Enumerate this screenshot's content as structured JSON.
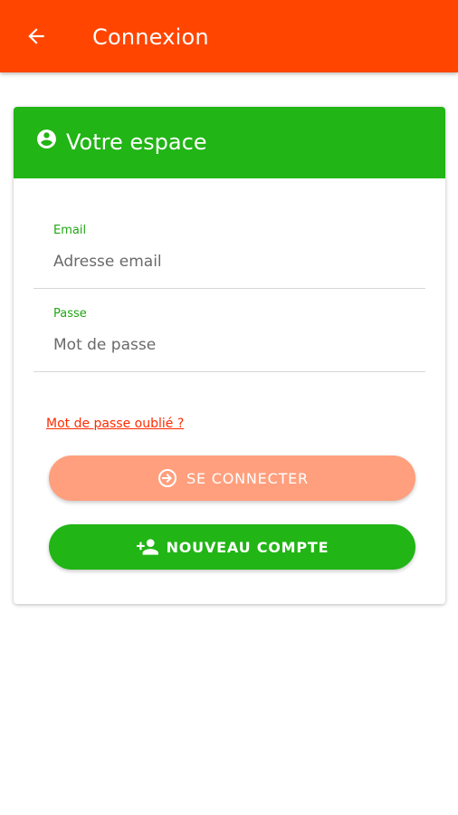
{
  "app_bar": {
    "title": "Connexion",
    "back_icon": "arrow-back-icon",
    "color": "#ff4500"
  },
  "card": {
    "header": {
      "title": "Votre espace",
      "icon": "account-circle-icon",
      "color": "#21b515"
    },
    "email": {
      "label": "Email",
      "value": "",
      "placeholder": "Adresse email"
    },
    "password": {
      "label": "Passe",
      "value": "",
      "placeholder": "Mot de passe"
    },
    "forgot_password": "Mot de passe oublié ?",
    "login_button": {
      "label": "SE CONNECTER",
      "icon": "login-icon",
      "color": "#ff9f7d"
    },
    "register_button": {
      "label": "NOUVEAU COMPTE",
      "icon": "person-add-icon",
      "color": "#21b515"
    }
  }
}
